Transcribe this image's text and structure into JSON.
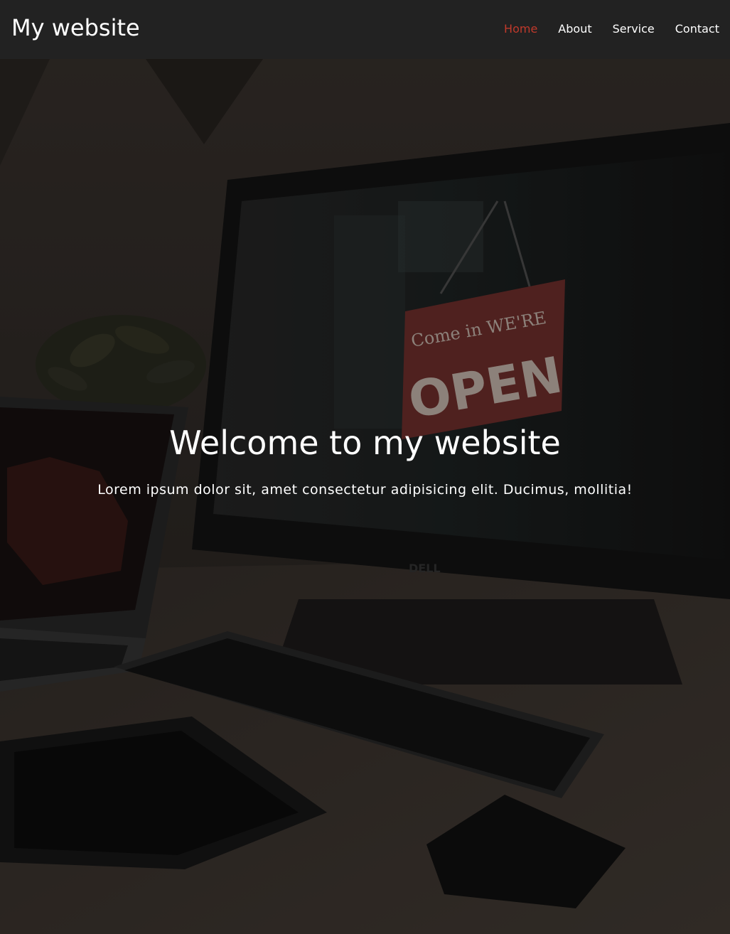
{
  "header": {
    "brand": "My website",
    "nav": [
      {
        "label": "Home",
        "active": true
      },
      {
        "label": "About",
        "active": false
      },
      {
        "label": "Service",
        "active": false
      },
      {
        "label": "Contact",
        "active": false
      }
    ]
  },
  "hero": {
    "title": "Welcome to my website",
    "subtitle": "Lorem ipsum dolor sit, amet consectetur adipisicing elit. Ducimus, mollitia!",
    "sign_text_top": "Come in WE'RE",
    "sign_text_main": "OPEN",
    "monitor_brand": "DELL"
  },
  "colors": {
    "navbar_bg": "#222222",
    "active_link": "#c0392b",
    "text": "#ffffff"
  }
}
